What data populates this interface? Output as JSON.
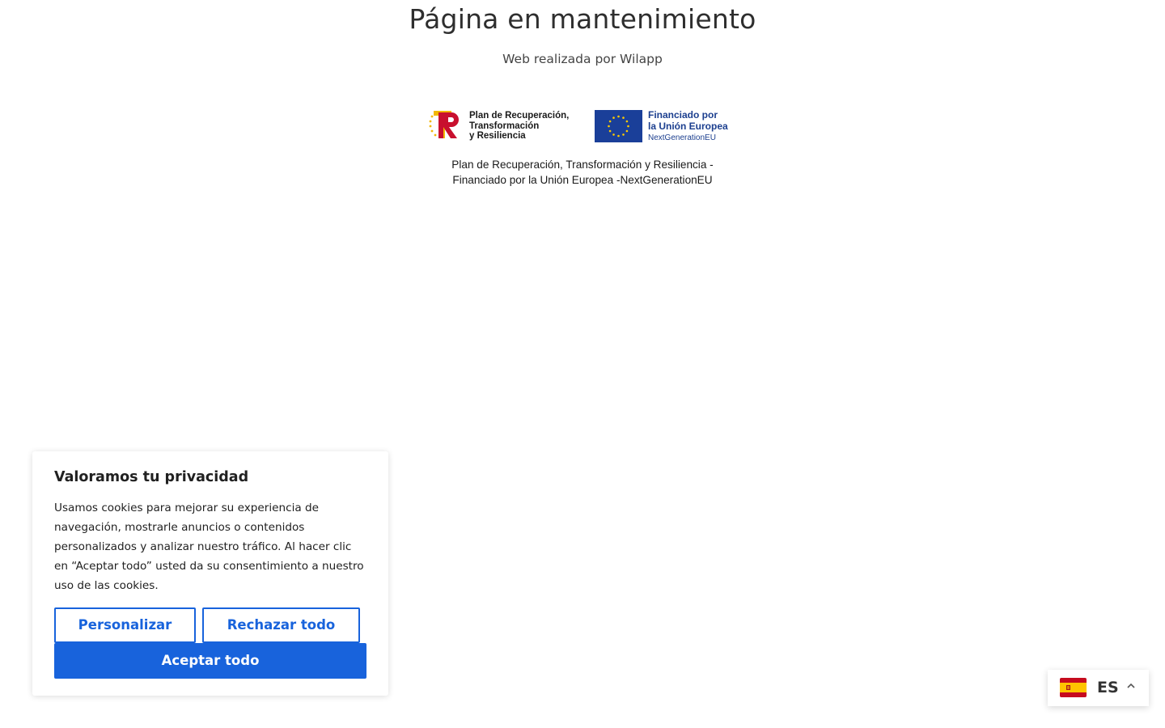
{
  "header": {
    "title": "Página en mantenimiento",
    "subtitle": "Web realizada por Wilapp"
  },
  "funding": {
    "prtr_lines": [
      "Plan de Recuperación,",
      "Transformación",
      "y Resiliencia"
    ],
    "eu_lines": [
      "Financiado por",
      "la Unión Europea",
      "NextGenerationEU"
    ],
    "caption_lines": [
      "Plan de Recuperación, Transformación y Resiliencia -",
      "Financiado por la Unión Europea -NextGenerationEU"
    ],
    "colors": {
      "prtr_red": "#c8102e",
      "prtr_yellow": "#f2b705",
      "eu_blue": "#1a3f99",
      "eu_star": "#ffcc00"
    }
  },
  "cookie_banner": {
    "title": "Valoramos tu privacidad",
    "text": "Usamos cookies para mejorar su experiencia de navegación, mostrarle anuncios o contenidos personalizados y analizar nuestro tráfico. Al hacer clic en “Aceptar todo” usted da su consentimiento a nuestro uso de las cookies.",
    "customize_label": "Personalizar",
    "reject_label": "Rechazar todo",
    "accept_label": "Aceptar todo",
    "accent_color": "#1863dc"
  },
  "language_switcher": {
    "code": "ES",
    "flag_icon": "spain-flag-icon",
    "chevron_icon": "chevron-up-icon"
  }
}
